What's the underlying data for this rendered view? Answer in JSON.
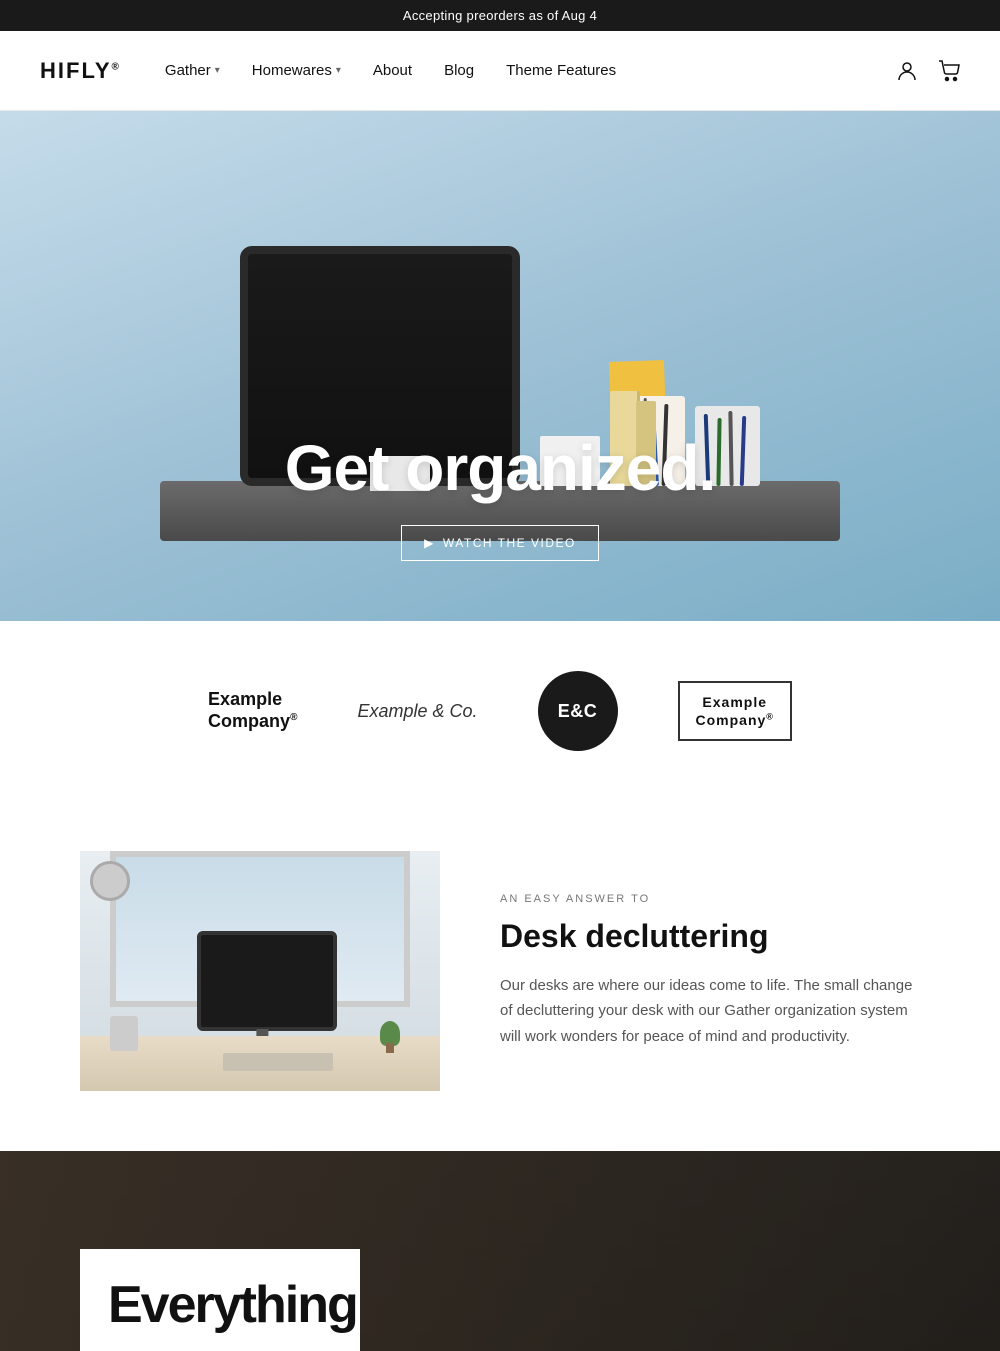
{
  "announcement": {
    "text": "Accepting preorders as of Aug 4"
  },
  "header": {
    "logo": "HIFLY",
    "logo_sup": "®",
    "nav": [
      {
        "label": "Gather",
        "hasDropdown": true
      },
      {
        "label": "Homewares",
        "hasDropdown": true
      },
      {
        "label": "About",
        "hasDropdown": false
      },
      {
        "label": "Blog",
        "hasDropdown": false
      },
      {
        "label": "Theme Features",
        "hasDropdown": false
      }
    ],
    "account_icon": "👤",
    "cart_icon": "🛒"
  },
  "hero": {
    "title": "Get organized.",
    "cta_label": "WATCH THE VIDEO",
    "cta_icon": "▶"
  },
  "logos": [
    {
      "type": "text-bold",
      "line1": "Example",
      "line2": "Company®"
    },
    {
      "type": "text-light",
      "text": "Example & Co."
    },
    {
      "type": "badge",
      "text": "E&C"
    },
    {
      "type": "bordered",
      "line1": "Example",
      "line2": "Company®"
    }
  ],
  "feature": {
    "label": "AN EASY ANSWER TO",
    "title": "Desk decluttering",
    "description": "Our desks are where our ideas come to life. The small change of decluttering your desk with our Gather organization system will work wonders for peace of mind and productivity."
  },
  "bottom": {
    "title": "Everything"
  }
}
